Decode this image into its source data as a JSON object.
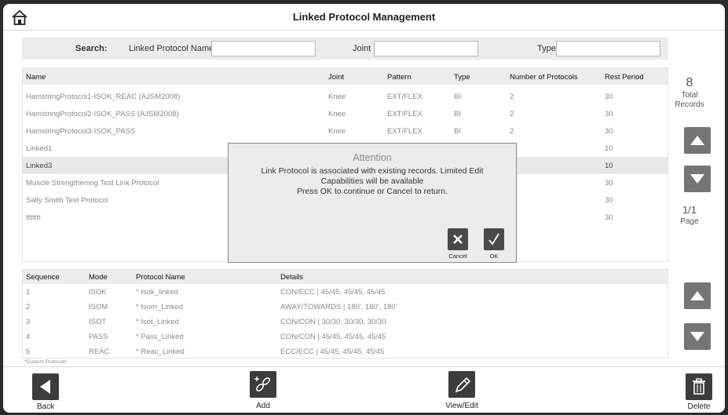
{
  "title": "Linked Protocol Management",
  "search": {
    "label": "Search:",
    "name_label": "Linked Protocol Name",
    "name_value": "",
    "joint_label": "Joint",
    "joint_value": "",
    "type_label": "Type",
    "type_value": ""
  },
  "protocol_table": {
    "columns": [
      "Name",
      "Joint",
      "Pattern",
      "Type",
      "Number of Protocols",
      "Rest Period"
    ],
    "rows": [
      {
        "name": "HamstringProtocol1-ISOK_REAC (AJSM2008)",
        "joint": "Knee",
        "pattern": "EXT/FLEX",
        "type": "BI",
        "count": "2",
        "rest": "30"
      },
      {
        "name": "HamstringProtocol2-ISOK_PASS (AJSM2008)",
        "joint": "Knee",
        "pattern": "EXT/FLEX",
        "type": "BI",
        "count": "2",
        "rest": "30"
      },
      {
        "name": "HamstringProtocol3-ISOK_PASS",
        "joint": "Knee",
        "pattern": "EXT/FLEX",
        "type": "BI",
        "count": "2",
        "rest": "30"
      },
      {
        "name": "Linked1",
        "joint": "",
        "pattern": "",
        "type": "",
        "count": "",
        "rest": "10"
      },
      {
        "name": "Linked3",
        "joint": "",
        "pattern": "",
        "type": "",
        "count": "",
        "rest": "10"
      },
      {
        "name": "Muscle Strengthening Test Link Protocol",
        "joint": "",
        "pattern": "",
        "type": "",
        "count": "",
        "rest": "30"
      },
      {
        "name": "Sally Smith Test Protocol",
        "joint": "",
        "pattern": "",
        "type": "",
        "count": "",
        "rest": "30"
      },
      {
        "name": "ttttttt",
        "joint": "",
        "pattern": "",
        "type": "",
        "count": "",
        "rest": "30"
      }
    ],
    "selected_index": 4
  },
  "records": {
    "total": "8",
    "total_label_1": "Total",
    "total_label_2": "Records",
    "page": "1/1",
    "page_label": "Page"
  },
  "sequence_table": {
    "columns": [
      "Sequence",
      "Mode",
      "Protocol Name",
      "Details"
    ],
    "rows": [
      {
        "seq": "1",
        "mode": "ISOK",
        "name": "* Isok_linked",
        "details": "CON/ECC |  45/45, 45/45, 45/45"
      },
      {
        "seq": "2",
        "mode": "ISOM",
        "name": "* Isom_Linked",
        "details": "AWAY/TOWARDS |  180', 180', 180'"
      },
      {
        "seq": "3",
        "mode": "ISOT",
        "name": "* Isot_Linked",
        "details": "CON/CON |  30/30, 30/30, 30/30"
      },
      {
        "seq": "4",
        "mode": "PASS",
        "name": "* Pass_Linked",
        "details": "CON/CON |  45/45, 45/45, 45/45"
      },
      {
        "seq": "5",
        "mode": "REAC",
        "name": "* Reac_Linked",
        "details": "ECC/ECC |  45/45, 45/45, 45/45"
      }
    ],
    "footnote": "*Custom Protocols"
  },
  "dialog": {
    "title": "Attention",
    "line1": "Link Protocol is associated with existing records. Limited Edit",
    "line2": "Capabilities will be available",
    "line3": "Press OK to continue or Cancel to return.",
    "cancel_label": "Cancel",
    "ok_label": "OK"
  },
  "toolbar": {
    "back": "Back",
    "add": "Add",
    "view_edit": "View/Edit",
    "delete": "Delete"
  },
  "icons": {
    "home": "home-icon",
    "up": "arrow-up-icon",
    "down": "arrow-down-icon",
    "back": "triangle-left-icon",
    "add": "link-add-icon",
    "edit": "pencil-icon",
    "delete": "trash-icon",
    "cancel": "x-icon",
    "ok": "check-icon"
  }
}
